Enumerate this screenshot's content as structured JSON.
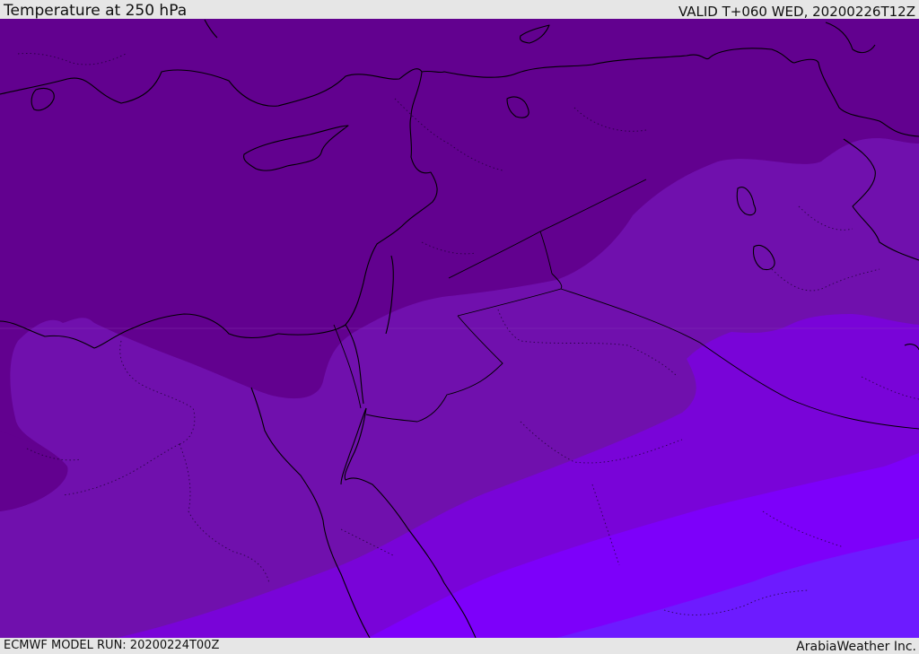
{
  "header": {
    "title": "Temperature at 250 hPa",
    "valid": "VALID T+060 WED, 20200226T12Z"
  },
  "footer": {
    "model_run": "ECMWF MODEL RUN: 20200224T00Z",
    "credit": "ArabiaWeather Inc."
  },
  "map": {
    "fill_colors": [
      "#62018f",
      "#7010ad",
      "#7904d8",
      "#7d00fa",
      "#6d1bff"
    ],
    "coastline_color": "#000000",
    "border_style": "dotted"
  }
}
